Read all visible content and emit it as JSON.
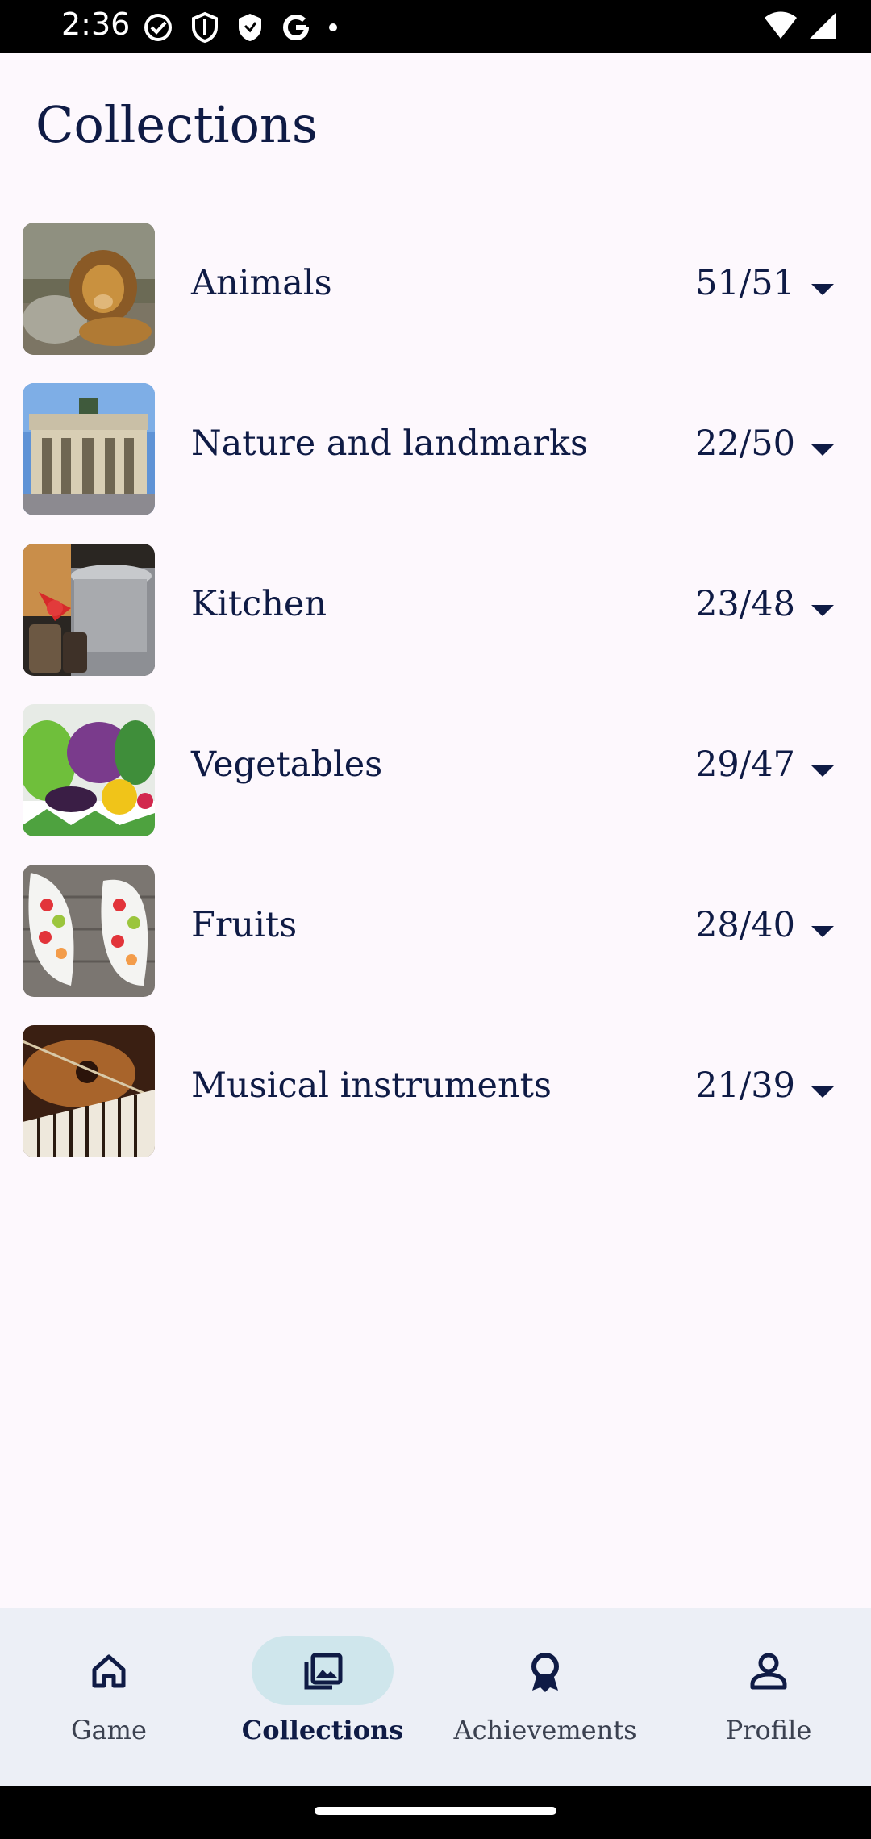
{
  "status_bar": {
    "time": "2:36",
    "icons": [
      "check-circle-icon",
      "shield-outline-icon",
      "shield-filled-icon",
      "google-icon",
      "dot-icon",
      "wifi-icon",
      "signal-icon"
    ]
  },
  "page": {
    "title": "Collections"
  },
  "collections": [
    {
      "label": "Animals",
      "count": "51/51",
      "thumb": "lion"
    },
    {
      "label": "Nature and landmarks",
      "count": "22/50",
      "thumb": "brandenburg-gate"
    },
    {
      "label": "Kitchen",
      "count": "23/48",
      "thumb": "kitchen-jars"
    },
    {
      "label": "Vegetables",
      "count": "29/47",
      "thumb": "vegetables"
    },
    {
      "label": "Fruits",
      "count": "28/40",
      "thumb": "fruit-bowls"
    },
    {
      "label": "Musical instruments",
      "count": "21/39",
      "thumb": "guitar-piano"
    }
  ],
  "bottom_nav": {
    "items": [
      {
        "label": "Game",
        "icon": "home-icon",
        "active": false
      },
      {
        "label": "Collections",
        "icon": "photo-library-icon",
        "active": true
      },
      {
        "label": "Achievements",
        "icon": "award-icon",
        "active": false
      },
      {
        "label": "Profile",
        "icon": "person-icon",
        "active": false
      }
    ]
  },
  "colors": {
    "background": "#fdf8fd",
    "text": "#0f1b45",
    "nav_background": "#eceff6",
    "nav_active_pill": "#cfe6ec"
  }
}
